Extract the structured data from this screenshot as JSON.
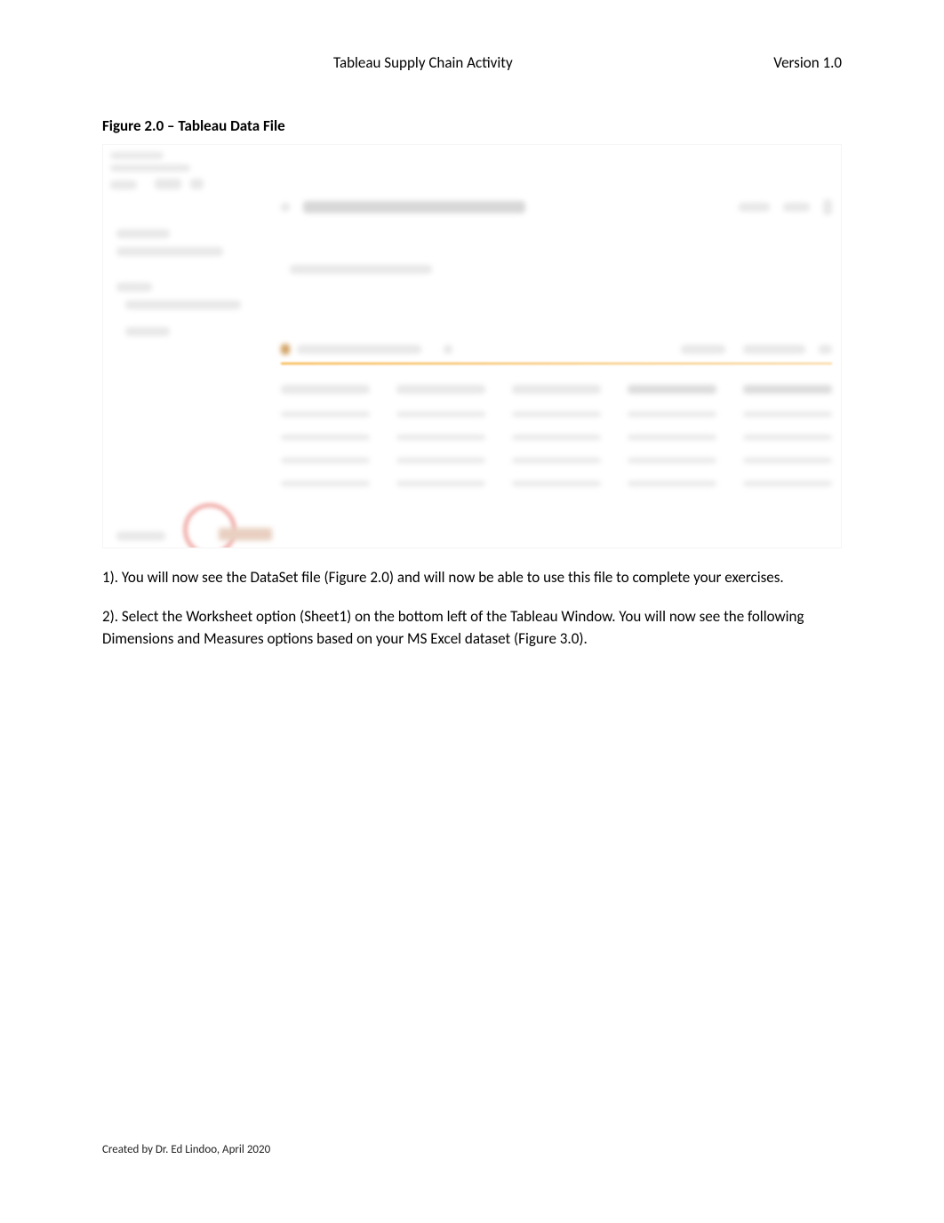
{
  "header": {
    "title": "Tableau Supply Chain Activity",
    "version": "Version 1.0"
  },
  "figure": {
    "caption": "Figure 2.0 – Tableau Data File"
  },
  "paragraphs": {
    "p1": "1). You will now see the DataSet file (Figure 2.0) and will now be able to use this file to complete your exercises.",
    "p2": "2). Select the Worksheet option (Sheet1) on the bottom left of the Tableau Window. You will now see the following Dimensions and Measures options based on your MS Excel dataset (Figure 3.0)."
  },
  "footer": {
    "text": "Created by Dr. Ed Lindoo, April 2020"
  }
}
